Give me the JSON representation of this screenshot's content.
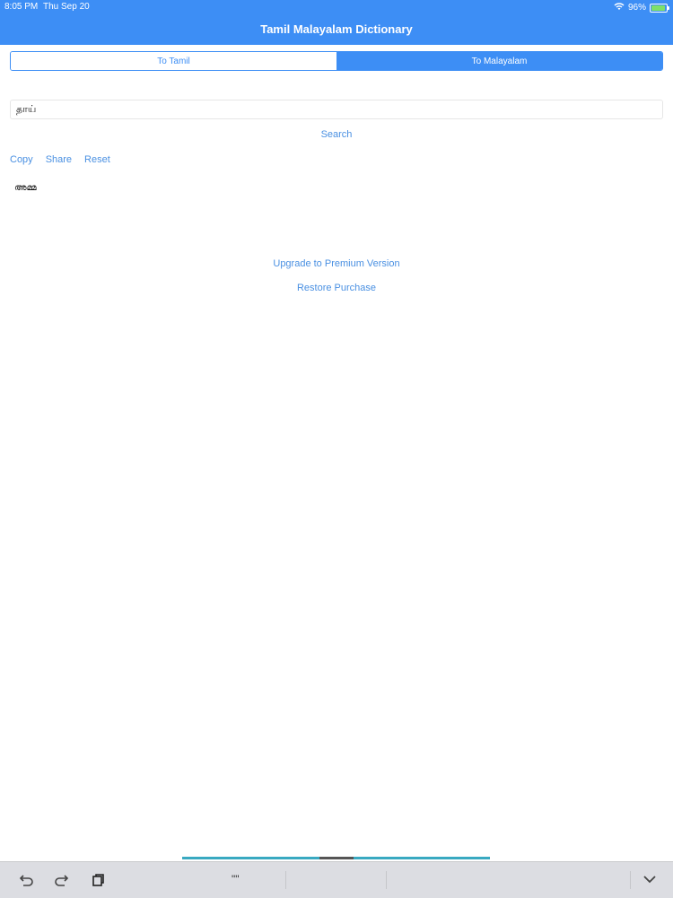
{
  "status": {
    "time": "8:05 PM",
    "date": "Thu Sep 20",
    "battery": "96%"
  },
  "app": {
    "title": "Tamil Malayalam Dictionary"
  },
  "segment": {
    "left_label": "To Tamil",
    "right_label": "To Malayalam"
  },
  "search": {
    "value": "தாய்",
    "button_label": "Search"
  },
  "actions": {
    "copy": "Copy",
    "share": "Share",
    "reset": "Reset"
  },
  "result": {
    "text": "അമ്മ"
  },
  "links": {
    "upgrade": "Upgrade to Premium Version",
    "restore": "Restore Purchase"
  },
  "toolbar": {
    "quote": "\"\""
  },
  "colors": {
    "accent": "#3d8ef5",
    "link": "#4a90e2"
  }
}
